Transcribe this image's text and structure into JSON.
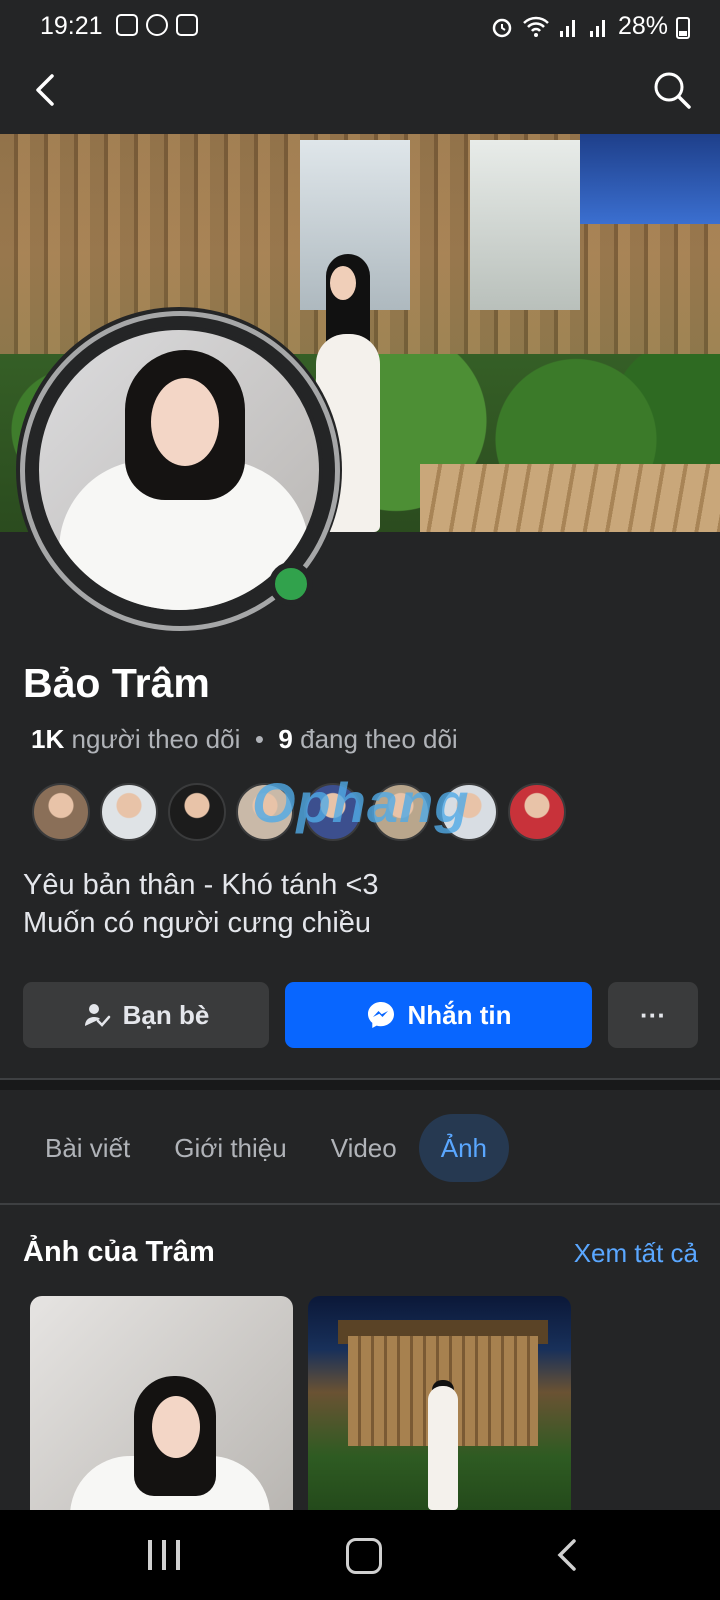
{
  "status_bar": {
    "time": "19:21",
    "battery": "28%"
  },
  "profile": {
    "name": "Bảo Trâm",
    "followers_count": "1K",
    "followers_label": "người theo dõi",
    "separator": "•",
    "following_count": "9",
    "following_label": "đang theo dõi",
    "bio_line1": "Yêu bản thân - Khó tánh <3",
    "bio_line2": "Muốn có người cưng chiều",
    "watermark": "Ophang"
  },
  "friend_avatar_colors": [
    "#8a6f58",
    "#dfe3e6",
    "#1c1c1c",
    "#c9b9a8",
    "#3c4f8e",
    "#b9a68c",
    "#d8dde3",
    "#c8323a"
  ],
  "actions": {
    "friends_label": "Bạn bè",
    "message_label": "Nhắn tin",
    "more_label": "···"
  },
  "tabs": [
    {
      "label": "Bài viết",
      "active": false
    },
    {
      "label": "Giới thiệu",
      "active": false
    },
    {
      "label": "Video",
      "active": false
    },
    {
      "label": "Ảnh",
      "active": true
    }
  ],
  "photos_section": {
    "title": "Ảnh của Trâm",
    "see_all": "Xem tất cả"
  },
  "colors": {
    "background": "#242526",
    "accent_blue": "#0866ff",
    "link_blue": "#5aa7ff",
    "online_green": "#31a24c"
  }
}
